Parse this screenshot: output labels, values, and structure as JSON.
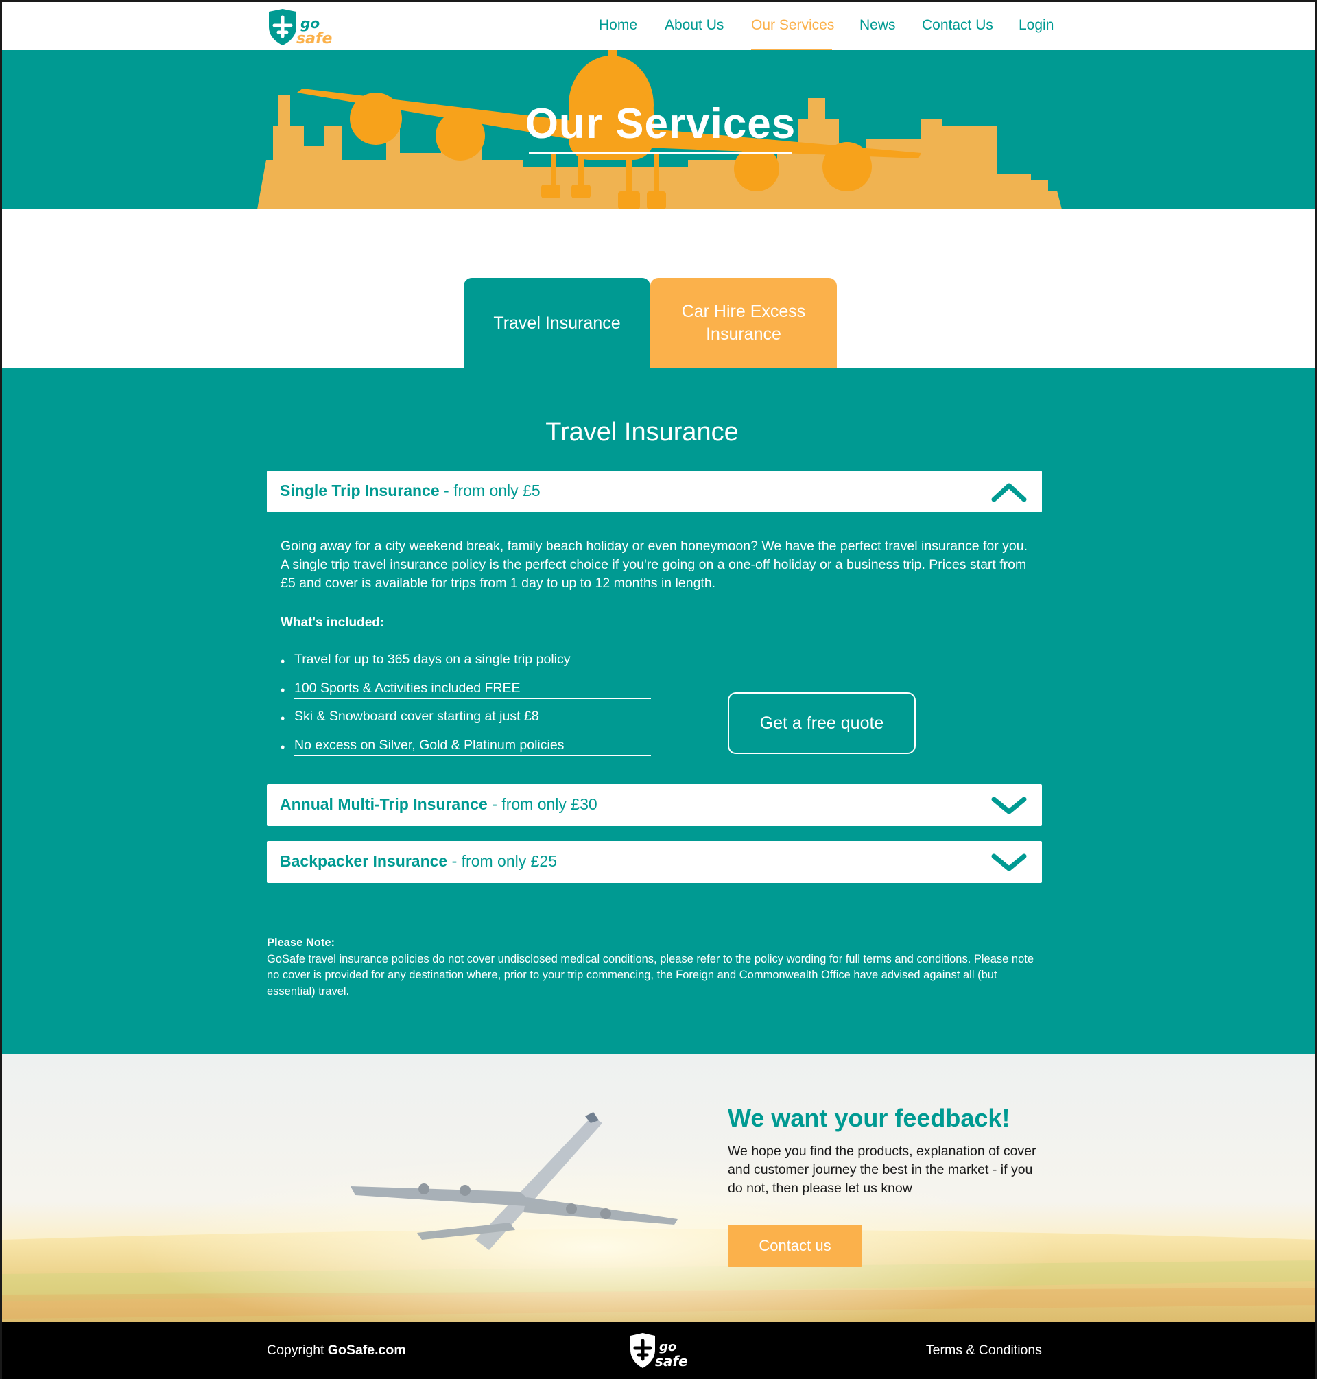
{
  "colors": {
    "teal": "#009a92",
    "orange": "#fbb14b",
    "white": "#ffffff",
    "black": "#000000"
  },
  "brand": {
    "logo_top": "go",
    "logo_bottom": "safe"
  },
  "nav": {
    "items": [
      {
        "label": "Home"
      },
      {
        "label": "About Us"
      },
      {
        "label": "Our Services"
      },
      {
        "label": "News"
      },
      {
        "label": "Contact Us"
      },
      {
        "label": "Login"
      }
    ],
    "active": "Our Services"
  },
  "hero": {
    "title": "Our Services"
  },
  "tabs": [
    {
      "label": "Travel Insurance"
    },
    {
      "label": "Car Hire Excess Insurance"
    }
  ],
  "section": {
    "title": "Travel Insurance",
    "accordions": [
      {
        "name": "Single Trip Insurance",
        "price": " - from only £5",
        "expanded": true,
        "icon": "chevron-up-icon"
      },
      {
        "name": "Annual Multi-Trip Insurance",
        "price": " - from only £30",
        "expanded": false,
        "icon": "chevron-down-icon"
      },
      {
        "name": "Backpacker Insurance",
        "price": " - from only £25",
        "expanded": false,
        "icon": "chevron-down-icon"
      }
    ],
    "panel": {
      "text": "Going away for a city weekend break, family beach holiday or even honeymoon? We have the perfect travel insurance for you. A single trip travel insurance policy is the perfect choice if you're going on a one-off holiday or a business trip. Prices start from £5 and cover is available for trips from 1 day to up to 12 months in length.",
      "included_title": "What's included:",
      "bullet": "•",
      "included": [
        "Travel for up to 365 days on a single trip policy",
        "100 Sports & Activities included FREE",
        "Ski & Snowboard cover starting at just £8",
        "No excess on Silver, Gold & Platinum policies"
      ],
      "cta": "Get a free quote"
    },
    "note": {
      "title": "Please Note:",
      "text": "GoSafe travel insurance policies do not cover undisclosed medical conditions, please refer to the policy wording for full terms and conditions. Please note no cover is provided for any destination where, prior to your trip commencing, the Foreign and Commonwealth Office have advised against all (but essential) travel."
    }
  },
  "feedback": {
    "title": "We want your feedback!",
    "text": "We hope you find the products, explanation of cover and customer journey the best in the market - if you do not, then please let us know",
    "button": "Contact us"
  },
  "footer": {
    "copyright_prefix": "Copyright ",
    "copyright_brand": "GoSafe.com",
    "terms": "Terms & Conditions"
  }
}
